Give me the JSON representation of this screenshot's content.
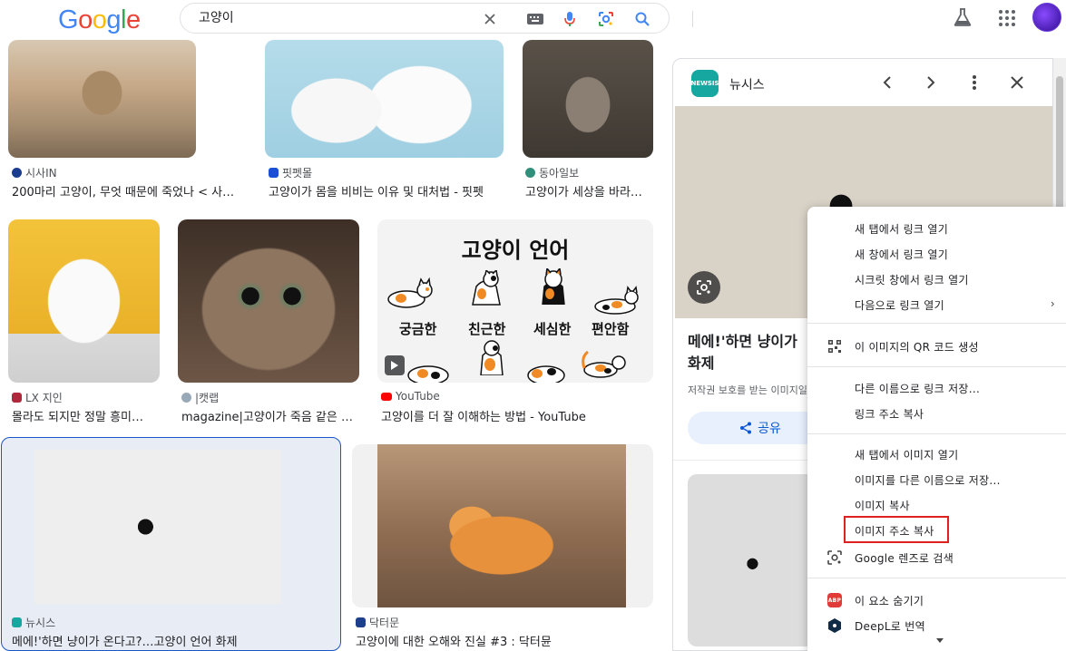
{
  "header": {
    "logo": [
      "G",
      "o",
      "o",
      "g",
      "l",
      "e"
    ],
    "logo_colors": [
      "#4285f4",
      "#ea4335",
      "#fbbc05",
      "#4285f4",
      "#34a853",
      "#ea4335"
    ],
    "search_value": "고양이"
  },
  "results": [
    {
      "source": "시사IN",
      "title": "200마리 고양이, 무엇 때문에 죽었나 < 사…",
      "fav_color": "#1a3d8f"
    },
    {
      "source": "핏펫몰",
      "title": "고양이가 몸을 비비는 이유 및 대처법 - 핏펫",
      "fav_color": "#1b4fd6"
    },
    {
      "source": "동아일보",
      "title": "고양이가 세상을 바라…",
      "fav_color": "#2f8f7a"
    },
    {
      "source": "LX 지인",
      "title": "몰라도 되지만 정말 흥미…",
      "fav_color": "#b0283c"
    },
    {
      "source": "|캣랩",
      "title": "magazine|고양이가 죽음 같은 …",
      "fav_color": "#9aa9b8"
    },
    {
      "source": "YouTube",
      "title": "고양이를 더 잘 이해하는 방법 - YouTube",
      "fav_color": "#ff0000"
    },
    {
      "source": "뉴시스",
      "title": "메에!'하면 냥이가 온다고?…고양이 언어 화제",
      "fav_color": "#16a7a0"
    },
    {
      "source": "닥터문",
      "title": "고양이에 대한 오해와 진실 #3 : 닥터뮨",
      "fav_color": "#1d3f8c"
    }
  ],
  "lang_card": {
    "title": "고양이 언어",
    "words": [
      "궁금한",
      "친근한",
      "세심한",
      "편안함"
    ]
  },
  "panel": {
    "logo_text": "NEWSIS",
    "source": "뉴시스",
    "title": "메에!'하면 냥이가 온다고? 고양이 언어 화제",
    "title_visible": "메에!'하면 냥이가 ",
    "title_line2": "화제",
    "note": "저작권 보호를 받는 이미지일",
    "share_label": "공유"
  },
  "context_menu": {
    "items": [
      "새 탭에서 링크 열기",
      "새 창에서 링크 열기",
      "시크릿 창에서 링크 열기",
      "다음으로 링크 열기",
      "이 이미지의 QR 코드 생성",
      "다른 이름으로 링크 저장...",
      "링크 주소 복사",
      "새 탭에서 이미지 열기",
      "이미지를 다른 이름으로 저장...",
      "이미지 복사",
      "이미지 주소 복사",
      "Google 렌즈로 검색",
      "이 요소 숨기기",
      "DeepL로 번역"
    ],
    "abp_label": "ABP",
    "highlighted": "이미지 주소 복사"
  }
}
